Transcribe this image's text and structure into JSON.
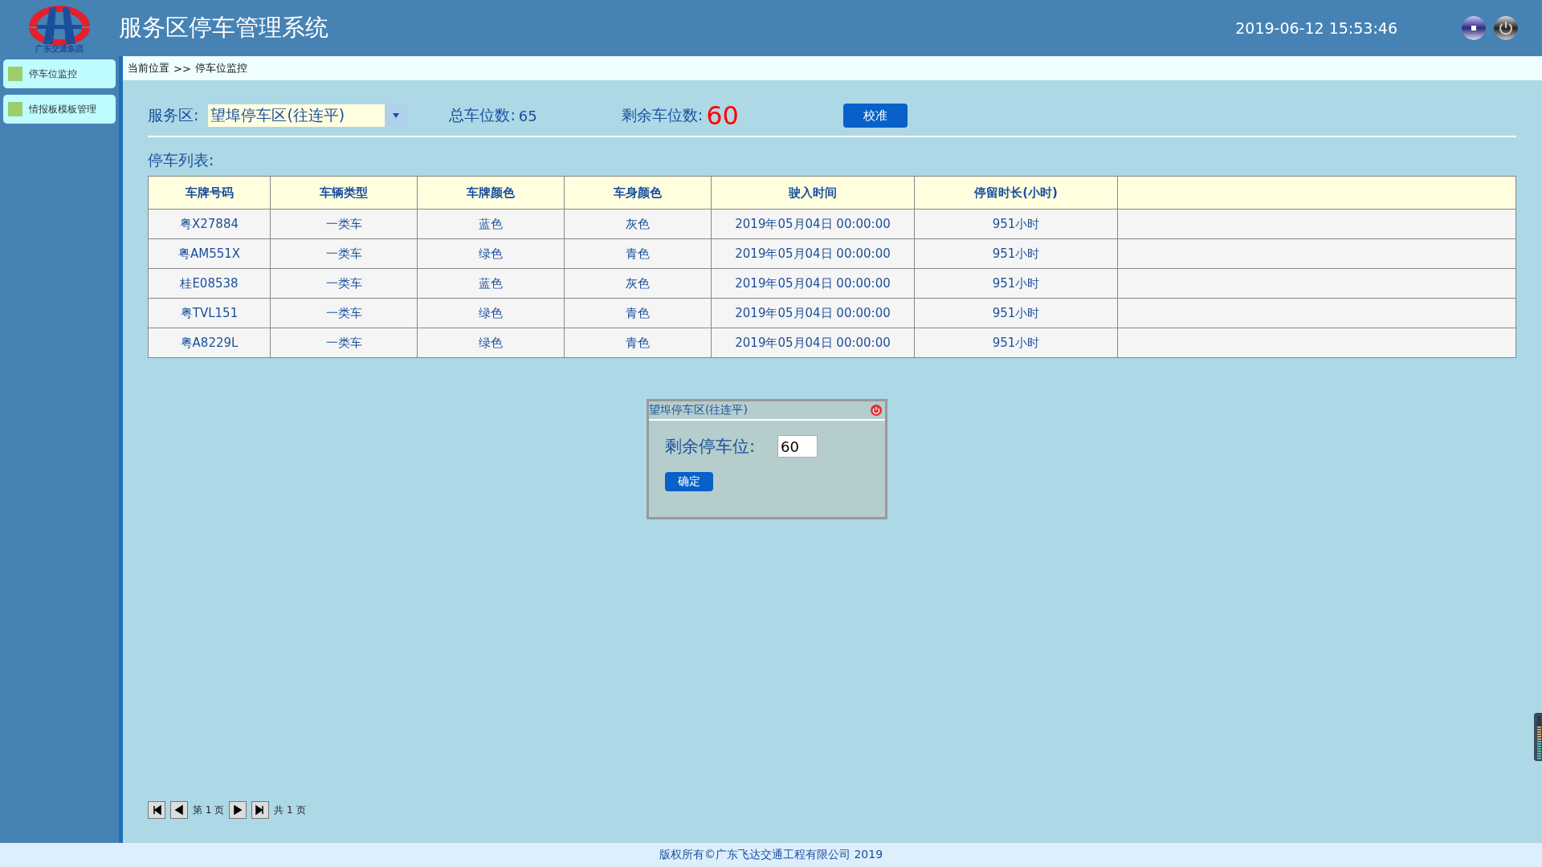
{
  "header": {
    "logo_text": "广东交通集团",
    "title": "服务区停车管理系统",
    "datetime": "2019-06-12 15:53:46"
  },
  "sidebar": {
    "items": [
      {
        "label": "停车位监控"
      },
      {
        "label": "情报板模板管理"
      }
    ]
  },
  "breadcrumb": {
    "label": "当前位置",
    "separator": ">>",
    "current": "停车位监控"
  },
  "toolbar": {
    "service_area_label": "服务区:",
    "service_area_value": "望埠停车区(往连平)",
    "total_label": "总车位数:",
    "total_value": "65",
    "remaining_label": "剩余车位数:",
    "remaining_value": "60",
    "calibrate_button": "校准"
  },
  "list_title": "停车列表:",
  "table": {
    "columns": [
      "车牌号码",
      "车辆类型",
      "车牌颜色",
      "车身颜色",
      "驶入时间",
      "停留时长(小时)"
    ],
    "rows": [
      [
        "粤X27884",
        "一类车",
        "蓝色",
        "灰色",
        "2019年05月04日 00:00:00",
        "951小时"
      ],
      [
        "粤AM551X",
        "一类车",
        "绿色",
        "青色",
        "2019年05月04日 00:00:00",
        "951小时"
      ],
      [
        "桂E08538",
        "一类车",
        "蓝色",
        "灰色",
        "2019年05月04日 00:00:00",
        "951小时"
      ],
      [
        "粤TVL151",
        "一类车",
        "绿色",
        "青色",
        "2019年05月04日 00:00:00",
        "951小时"
      ],
      [
        "粤A8229L",
        "一类车",
        "绿色",
        "青色",
        "2019年05月04日 00:00:00",
        "951小时"
      ]
    ]
  },
  "dialog": {
    "title": "望埠停车区(往连平)",
    "field_label": "剩余停车位:",
    "field_value": "60",
    "ok_button": "确定"
  },
  "pager": {
    "page_text": "第 1 页",
    "total_text": "共 1 页"
  },
  "footer": "版权所有©广东飞达交通工程有限公司 2019"
}
